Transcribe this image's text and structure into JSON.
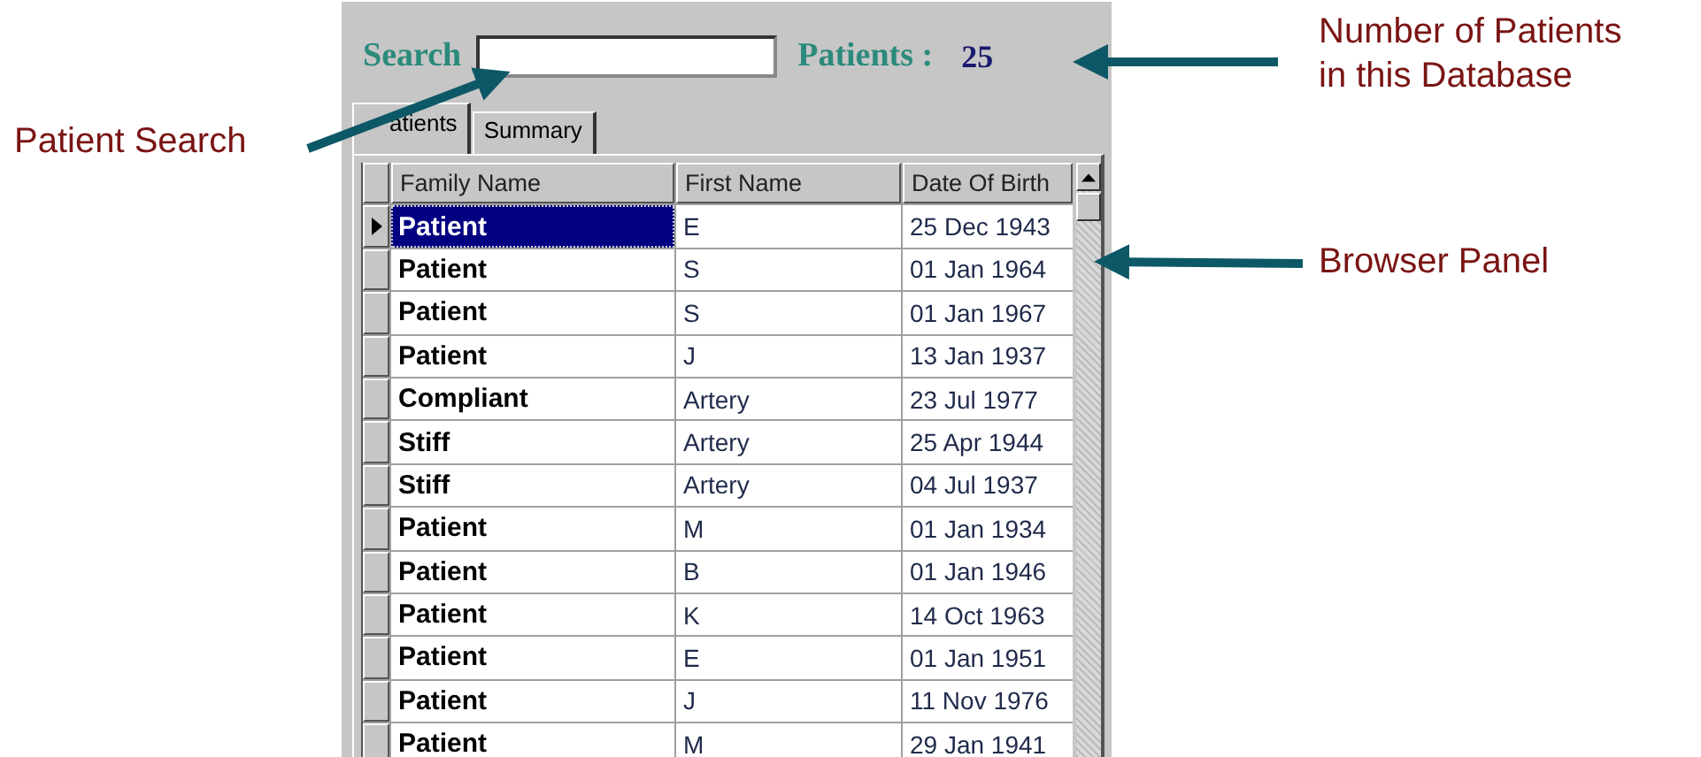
{
  "annotations": [
    {
      "kind": "search",
      "text": "Patient Search"
    },
    {
      "kind": "count",
      "text": "Number of Patients\nin this Database"
    },
    {
      "kind": "browser",
      "text": "Browser Panel"
    }
  ],
  "search": {
    "label": "Search"
  },
  "patient_count": {
    "label": "Patients :",
    "value": "25"
  },
  "tabs": [
    {
      "label": "atients",
      "selected": true
    },
    {
      "label": "Summary",
      "selected": false
    }
  ],
  "table": {
    "columns": [
      "Family Name",
      "First Name",
      "Date Of Birth"
    ],
    "rows": [
      {
        "family_name": "Patient",
        "first_name": "E",
        "date_of_birth": "25 Dec 1943",
        "selected": true
      },
      {
        "family_name": "Patient",
        "first_name": "S",
        "date_of_birth": "01 Jan 1964",
        "selected": false
      },
      {
        "family_name": "Patient",
        "first_name": "S",
        "date_of_birth": "01 Jan 1967",
        "selected": false
      },
      {
        "family_name": "Patient",
        "first_name": "J",
        "date_of_birth": "13 Jan 1937",
        "selected": false
      },
      {
        "family_name": "Compliant",
        "first_name": "Artery",
        "date_of_birth": "23 Jul 1977",
        "selected": false
      },
      {
        "family_name": "Stiff",
        "first_name": "Artery",
        "date_of_birth": "25 Apr 1944",
        "selected": false
      },
      {
        "family_name": "Stiff",
        "first_name": "Artery",
        "date_of_birth": "04 Jul 1937",
        "selected": false
      },
      {
        "family_name": "Patient",
        "first_name": "M",
        "date_of_birth": "01 Jan 1934",
        "selected": false
      },
      {
        "family_name": "Patient",
        "first_name": "B",
        "date_of_birth": "01 Jan 1946",
        "selected": false
      },
      {
        "family_name": "Patient",
        "first_name": "K",
        "date_of_birth": "14 Oct 1963",
        "selected": false
      },
      {
        "family_name": "Patient",
        "first_name": "E",
        "date_of_birth": "01 Jan 1951",
        "selected": false
      },
      {
        "family_name": "Patient",
        "first_name": "J",
        "date_of_birth": "11 Nov 1976",
        "selected": false
      },
      {
        "family_name": "Patient",
        "first_name": "M",
        "date_of_birth": "29 Jan 1941",
        "selected": false
      }
    ]
  }
}
